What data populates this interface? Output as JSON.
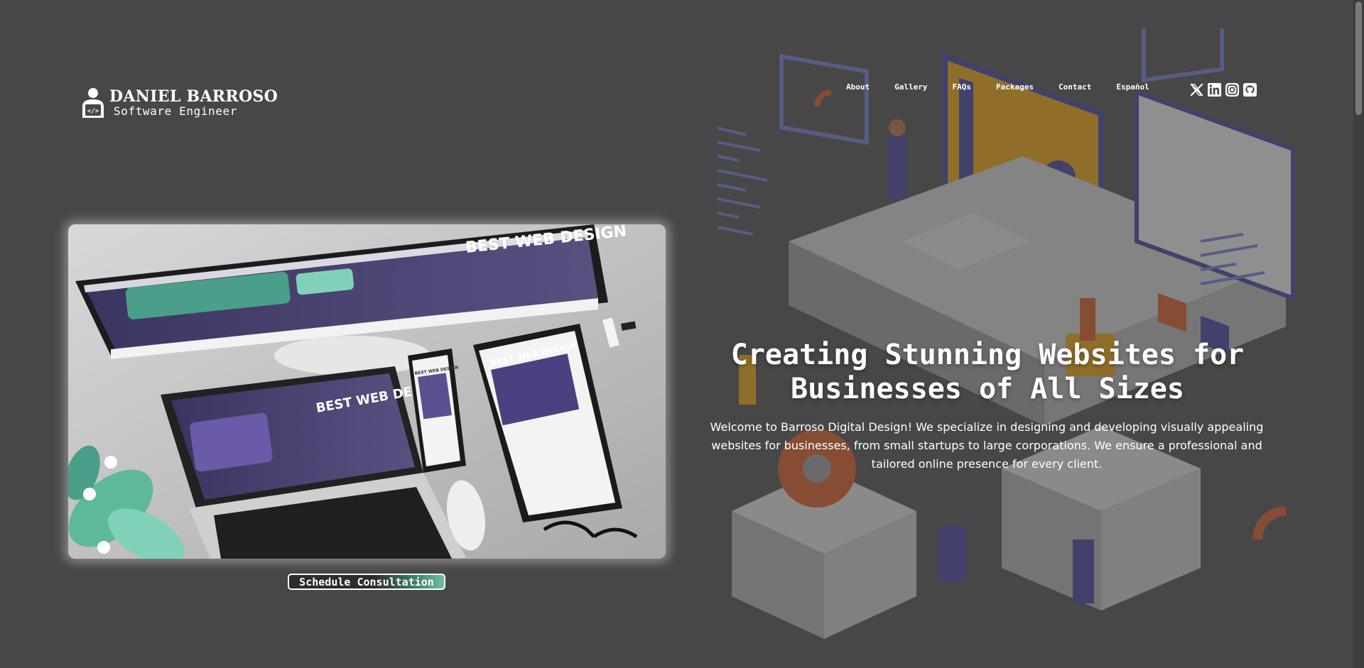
{
  "brand": {
    "name": "DANIEL BARROSO",
    "role": "Software Engineer"
  },
  "nav": {
    "items": [
      {
        "label": "About"
      },
      {
        "label": "Gallery"
      },
      {
        "label": "FAQs"
      },
      {
        "label": "Packages"
      },
      {
        "label": "Contact"
      },
      {
        "label": "Español"
      }
    ]
  },
  "social": {
    "icons": [
      "x-icon",
      "linkedin-icon",
      "instagram-icon",
      "github-icon"
    ]
  },
  "hero": {
    "image_text": {
      "monitor": "BEST WEB DESIGN",
      "laptop": "BEST WEB DESIGN",
      "phone": "BEST WEB DESIGN",
      "tablet": "BEST WEB DESIGN"
    },
    "cta_label": "Schedule Consultation"
  },
  "headline": {
    "line1": "Creating Stunning Websites for",
    "line2": "Businesses of All Sizes"
  },
  "intro": "Welcome to Barroso Digital Design! We specialize in designing and developing visually appealing websites for businesses, from small startups to large corporations. We ensure a professional and tailored online presence for every client.",
  "colors": {
    "background": "#474747",
    "accent_purple": "#5b4c9a",
    "accent_teal": "#5fb89a",
    "cta_gradient_end": "#6fc09f"
  }
}
